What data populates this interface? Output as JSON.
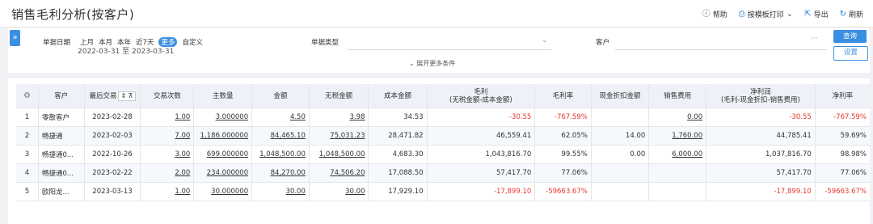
{
  "header": {
    "title": "销售毛利分析(按客户)",
    "actions": {
      "help": "帮助",
      "print": "按模板打印",
      "export": "导出",
      "refresh": "刷新"
    }
  },
  "filters": {
    "date_label": "单据日期",
    "date_options": [
      "上月",
      "本月",
      "本年",
      "近7天",
      "更多",
      "自定义"
    ],
    "date_range": "2022-03-31 至 2023-03-31",
    "doc_type_label": "单据类型",
    "customer_label": "客户",
    "query_button": "查询",
    "settings_button": "设置",
    "more_toggle": "展开更多条件"
  },
  "table": {
    "headers": {
      "no": "",
      "customer": "客户",
      "last_trade": "最后交易",
      "count": "交易次数",
      "qty": "主数量",
      "amount": "金额",
      "notax": "无税金额",
      "cost": "成本金额",
      "profit_line1": "毛利",
      "profit_line2": "(无税金额-成本金额)",
      "margin": "毛利率",
      "discount": "现金折扣金额",
      "expense": "销售费用",
      "net_line1": "净利润",
      "net_line2": "(毛利-现金折扣-销售费用)",
      "net_rate": "净利率"
    },
    "rows": [
      {
        "no": "1",
        "customer": "零散客户",
        "date": "2023-02-28",
        "count": "1.00",
        "qty": "3.000000",
        "amount": "4.50",
        "notax": "3.98",
        "cost": "34.53",
        "profit": "-30.55",
        "margin": "-767.59%",
        "discount": "",
        "expense": "0.00",
        "net": "-30.55",
        "net_rate": "-767.59%"
      },
      {
        "no": "2",
        "customer": "畅捷通",
        "date": "2023-02-03",
        "count": "7.00",
        "qty": "1,186.000000",
        "amount": "84,465.10",
        "notax": "75,031.23",
        "cost": "28,471.82",
        "profit": "46,559.41",
        "margin": "62.05%",
        "discount": "14.00",
        "expense": "1,760.00",
        "net": "44,785.41",
        "net_rate": "59.69%"
      },
      {
        "no": "3",
        "customer": "畅捷通0...",
        "date": "2022-10-26",
        "count": "3.00",
        "qty": "699.000000",
        "amount": "1,048,500.00",
        "notax": "1,048,500.00",
        "cost": "4,683.30",
        "profit": "1,043,816.70",
        "margin": "99.55%",
        "discount": "0.00",
        "expense": "6,000.00",
        "net": "1,037,816.70",
        "net_rate": "98.98%"
      },
      {
        "no": "4",
        "customer": "畅捷通0...",
        "date": "2023-02-22",
        "count": "2.00",
        "qty": "234.000000",
        "amount": "84,270.00",
        "notax": "74,506.20",
        "cost": "17,088.50",
        "profit": "57,417.70",
        "margin": "77.06%",
        "discount": "",
        "expense": "",
        "net": "57,417.70",
        "net_rate": "77.06%"
      },
      {
        "no": "5",
        "customer": "欧阳龙...",
        "date": "2023-03-13",
        "count": "1.00",
        "qty": "30.000000",
        "amount": "30.00",
        "notax": "30.00",
        "cost": "17,929.10",
        "profit": "-17,899.10",
        "margin": "-59663.67%",
        "discount": "",
        "expense": "",
        "net": "-17,899.10",
        "net_rate": "-59663.67%"
      }
    ]
  },
  "colors": {
    "accent": "#3b8fe3",
    "negative": "#e8382f",
    "header_bg": "#eef2f8",
    "page_bg": "#f0f2f5"
  }
}
